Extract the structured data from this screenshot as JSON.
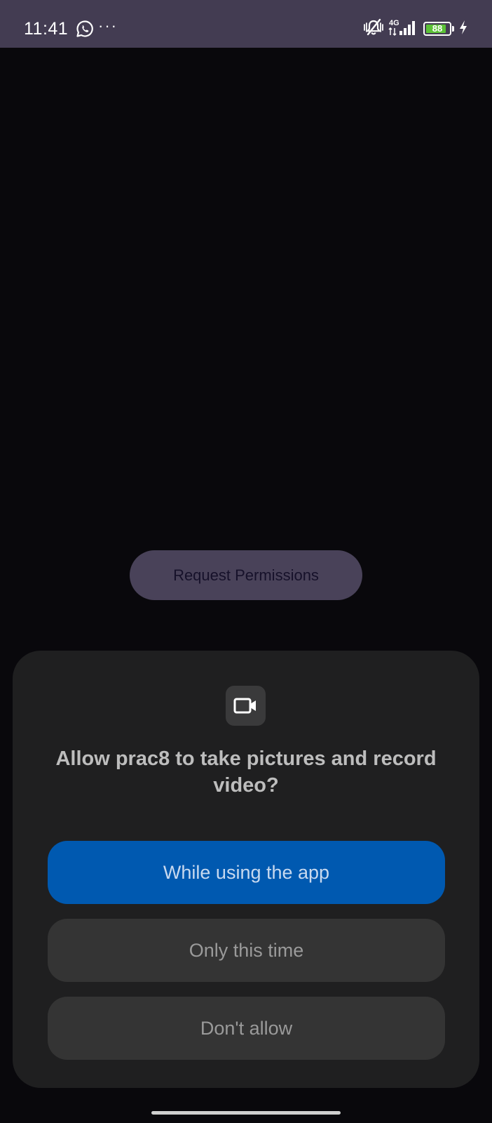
{
  "status_bar": {
    "time": "11:41",
    "more_dots": "···",
    "network": "4G",
    "battery_level": "88",
    "battery_fraction": 0.88,
    "battery_color": "#5bc236",
    "icons": [
      "whatsapp-icon",
      "more-notifications-icon",
      "vibrate-mute-icon",
      "4g-signal-icon",
      "battery-icon",
      "charging-bolt-icon"
    ]
  },
  "main": {
    "request_button_label": "Request Permissions"
  },
  "permission_dialog": {
    "icon": "video-camera-icon",
    "title": "Allow prac8 to take pictures and record video?",
    "buttons": {
      "while_using": "While using the app",
      "only_this_time": "Only this time",
      "dont_allow": "Don't allow"
    },
    "accent_color": "#0059b0"
  }
}
